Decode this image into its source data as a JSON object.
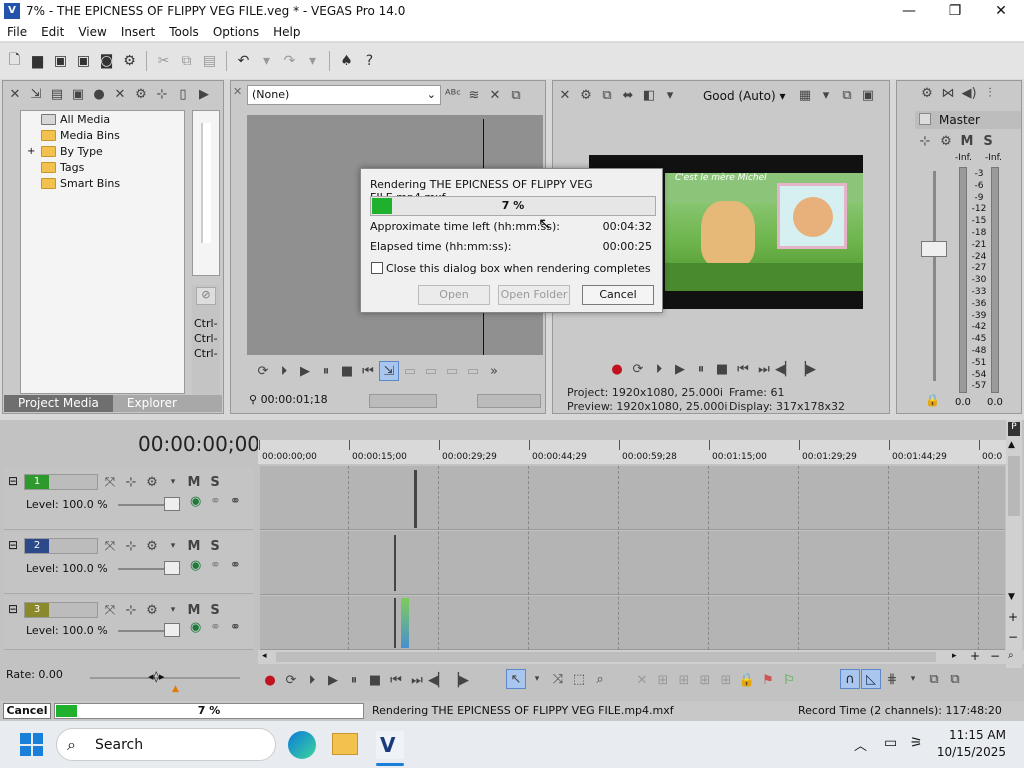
{
  "window": {
    "title": "7% - THE EPICNESS OF FLIPPY VEG FILE.veg * - VEGAS Pro 14.0",
    "minimize": "—",
    "maximize": "❐",
    "close": "✕"
  },
  "menu": [
    "File",
    "Edit",
    "View",
    "Insert",
    "Tools",
    "Options",
    "Help"
  ],
  "explorer": {
    "items": [
      "All Media",
      "Media Bins",
      "By Type",
      "Tags",
      "Smart Bins"
    ],
    "expander": "+",
    "tabs": [
      "Project Media",
      "Explorer"
    ]
  },
  "trimmer": {
    "dropdown": "(None)",
    "timecode": "00:00:01;18",
    "side_labels": [
      "Ctrl-",
      "Ctrl-",
      "Ctrl-"
    ]
  },
  "preview": {
    "quality": "Good (Auto)",
    "project": "Project:  1920x1080, 25.000i",
    "preview": "Preview:  1920x1080, 25.000i",
    "frame": "Frame:      61",
    "display": "Display:    317x178x32",
    "video_caption": "C'est le mère Michel"
  },
  "mixer": {
    "title": "Master",
    "left_peak": "-Inf.",
    "right_peak": "-Inf.",
    "scale": [
      "3",
      "6",
      "9",
      "12",
      "15",
      "18",
      "21",
      "24",
      "27",
      "30",
      "33",
      "36",
      "39",
      "42",
      "45",
      "48",
      "51",
      "54",
      "57"
    ],
    "left_val": "0.0",
    "right_val": "0.0"
  },
  "render_dialog": {
    "title": "Rendering THE EPICNESS OF FLIPPY VEG FILE.mp4.mxf",
    "percent_label": "7 %",
    "progress": 0.07,
    "time_left_label": "Approximate time left (hh:mm:ss):",
    "time_left": "00:04:32",
    "elapsed_label": "Elapsed time (hh:mm:ss):",
    "elapsed": "00:00:25",
    "close_checkbox": "Close this dialog box when rendering completes",
    "open": "Open",
    "open_folder": "Open Folder",
    "cancel": "Cancel"
  },
  "timeline": {
    "time": "00:00:00;00",
    "ruler": [
      "00:00:00;00",
      "00:00:15;00",
      "00:00:29;29",
      "00:00:44;29",
      "00:00:59;28",
      "00:01:15;00",
      "00:01:29;29",
      "00:01:44;29",
      "00:0"
    ],
    "tracks": [
      {
        "num": "1",
        "level": "Level: 100.0 %",
        "color": "#2e9a2e"
      },
      {
        "num": "2",
        "level": "Level: 100.0 %",
        "color": "#2c4a8a"
      },
      {
        "num": "3",
        "level": "Level: 100.0 %",
        "color": "#8a8a2c"
      }
    ],
    "rate": "Rate: 0.00"
  },
  "status": {
    "cancel": "Cancel",
    "percent": "7 %",
    "message": "Rendering THE EPICNESS OF FLIPPY VEG FILE.mp4.mxf",
    "record_time": "Record Time (2 channels): 117:48:20"
  },
  "taskbar": {
    "search": "Search",
    "time": "11:15 AM",
    "date": "10/15/2025"
  }
}
